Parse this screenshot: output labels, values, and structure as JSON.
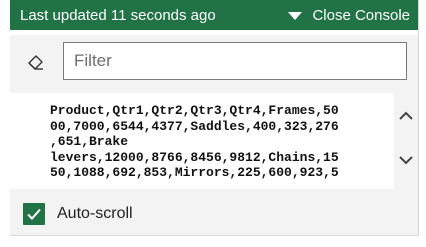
{
  "header": {
    "status_text": "Last updated 11 seconds ago",
    "toggle_label": "Close Console"
  },
  "toolbar": {
    "clear_icon": "eraser-icon",
    "filter_placeholder": "Filter",
    "filter_value": ""
  },
  "log": {
    "text": "Product,Qtr1,Qtr2,Qtr3,Qtr4,Frames,50\n00,7000,6544,4377,Saddles,400,323,276\n,651,Brake\nlevers,12000,8766,8456,9812,Chains,15\n50,1088,692,853,Mirrors,225,600,923,5"
  },
  "scroll": {
    "up_icon": "chevron-up-icon",
    "down_icon": "chevron-down-icon"
  },
  "autoscroll": {
    "label": "Auto-scroll",
    "checked": true
  },
  "colors": {
    "accent": "#217346",
    "panel": "#f3f3f3",
    "log_bg": "#ffffff"
  }
}
